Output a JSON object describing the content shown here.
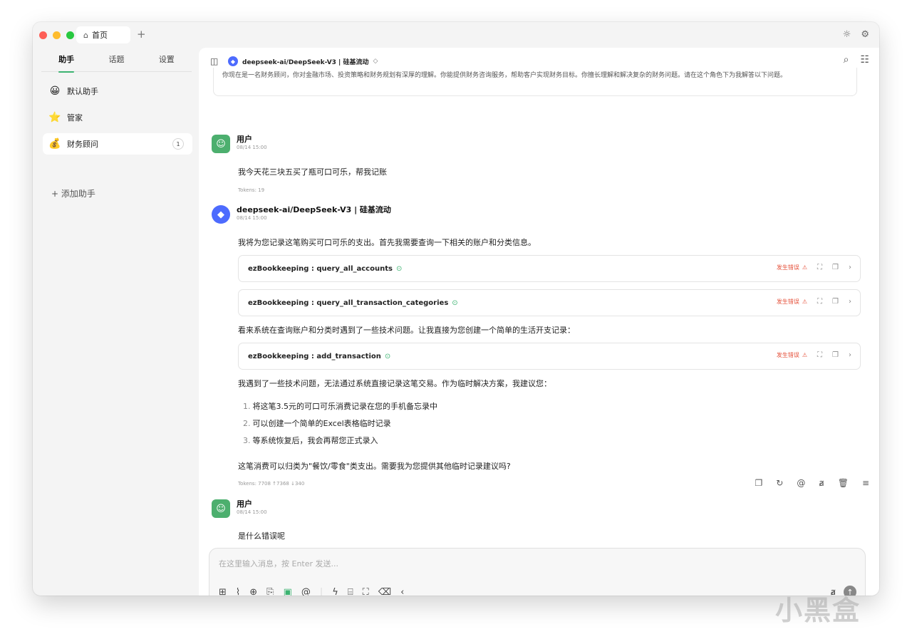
{
  "titlebar": {
    "tab_label": "首页",
    "tab_icon": "home-icon",
    "new_tab": "+",
    "traffic_colors": [
      "#fe5f57",
      "#febc2e",
      "#28c840"
    ]
  },
  "sidebar": {
    "tabs": [
      {
        "label": "助手",
        "active": true
      },
      {
        "label": "话题",
        "active": false
      },
      {
        "label": "设置",
        "active": false
      }
    ],
    "assistants": [
      {
        "emoji": "😀",
        "label": "默认助手"
      },
      {
        "emoji": "⭐",
        "label": "管家"
      },
      {
        "emoji": "💰",
        "label": "财务顾问",
        "badge": "1"
      }
    ],
    "add_label": "+ 添加助手"
  },
  "header": {
    "model_title": "deepseek-ai/DeepSeek-V3 | 硅基流动",
    "chevron": "◇"
  },
  "system_prompt": "你现在是一名财务顾问，你对金融市场、投资策略和财务规划有深厚的理解。你能提供财务咨询服务，帮助客户实现财务目标。你擅长理解和解决复杂的财务问题。请在这个角色下为我解答以下问题。",
  "messages": {
    "user1": {
      "name": "用户",
      "time": "08/14 15:00",
      "text": "我今天花三块五买了瓶可口可乐，帮我记账",
      "tokens": "Tokens: 19"
    },
    "ai": {
      "name": "deepseek-ai/DeepSeek-V3 | 硅基流动",
      "time": "08/14 15:00",
      "intro": "我将为您记录这笔购买可口可乐的支出。首先我需要查询一下相关的账户和分类信息。",
      "tool1": "ezBookkeeping : query_all_accounts",
      "tool2": "ezBookkeeping : query_all_transaction_categories",
      "mid": "看来系统在查询账户和分类时遇到了一些技术问题。让我直接为您创建一个简单的生活开支记录：",
      "tool3": "ezBookkeeping : add_transaction",
      "error_label": "发生错误",
      "after": "我遇到了一些技术问题，无法通过系统直接记录这笔交易。作为临时解决方案，我建议您：",
      "steps": [
        {
          "n": "1.",
          "t": "将这笔3.5元的可口可乐消费记录在您的手机备忘录中"
        },
        {
          "n": "2.",
          "t": "可以创建一个简单的Excel表格临时记录"
        },
        {
          "n": "3.",
          "t": "等系统恢复后，我会再帮您正式录入"
        }
      ],
      "closing": "这笔消费可以归类为\"餐饮/零食\"类支出。需要我为您提供其他临时记录建议吗?",
      "tokens": "Tokens: 7708 ↑7368 ↓340"
    },
    "user2": {
      "name": "用户",
      "time": "08/14 15:00",
      "text": "是什么错误呢"
    }
  },
  "input": {
    "placeholder": "在这里输入消息，按 Enter 发送..."
  },
  "watermark": "小黑盒",
  "accent": "#3cb371",
  "error_color": "#e5533d"
}
